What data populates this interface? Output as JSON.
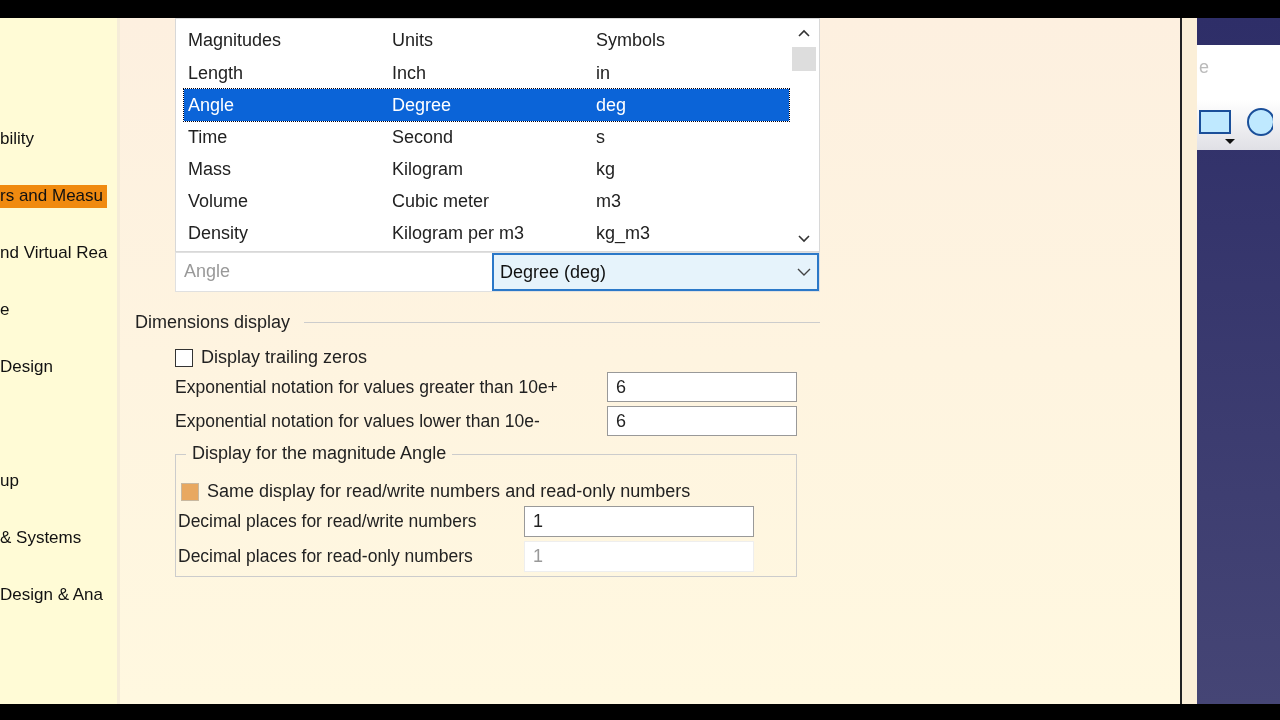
{
  "sidebar": {
    "items": [
      {
        "label": "bility",
        "selected": false
      },
      {
        "label": "rs and Measu",
        "selected": true
      },
      {
        "label": "nd Virtual Rea",
        "selected": false
      },
      {
        "label": "e",
        "selected": false
      },
      {
        "label": "Design",
        "selected": false
      },
      {
        "label": "up",
        "selected": false
      },
      {
        "label": "& Systems",
        "selected": false
      },
      {
        "label": "Design & Ana",
        "selected": false
      }
    ]
  },
  "units_table": {
    "columns": [
      "Magnitudes",
      "Units",
      "Symbols"
    ],
    "rows": [
      {
        "cells": [
          "Length",
          "Inch",
          "in"
        ],
        "selected": false
      },
      {
        "cells": [
          "Angle",
          "Degree",
          "deg"
        ],
        "selected": true
      },
      {
        "cells": [
          "Time",
          "Second",
          "s"
        ],
        "selected": false
      },
      {
        "cells": [
          "Mass",
          "Kilogram",
          "kg"
        ],
        "selected": false
      },
      {
        "cells": [
          "Volume",
          "Cubic meter",
          "m3"
        ],
        "selected": false
      },
      {
        "cells": [
          "Density",
          "Kilogram per m3",
          "kg_m3"
        ],
        "selected": false
      }
    ],
    "current_magnitude": "Angle",
    "unit_dropdown": "Degree (deg)"
  },
  "dimensions_display": {
    "title": "Dimensions display",
    "trailing_zeros": {
      "label": "Display trailing zeros",
      "checked": false
    },
    "fields": [
      {
        "label": "Exponential notation for values greater than 10e+",
        "value": "6"
      },
      {
        "label": "Exponential notation for values lower than 10e-",
        "value": "6"
      }
    ],
    "magnitude_group": {
      "title": "Display for the magnitude Angle",
      "same_display": {
        "label": "Same display for read/write numbers and read-only numbers",
        "checked": true,
        "disabled": true
      },
      "fields": [
        {
          "label": "Decimal places for read/write numbers",
          "value": "1",
          "disabled": false
        },
        {
          "label": "Decimal places for read-only numbers",
          "value": "1",
          "disabled": true
        }
      ]
    }
  },
  "background_window": {
    "text": "e"
  }
}
